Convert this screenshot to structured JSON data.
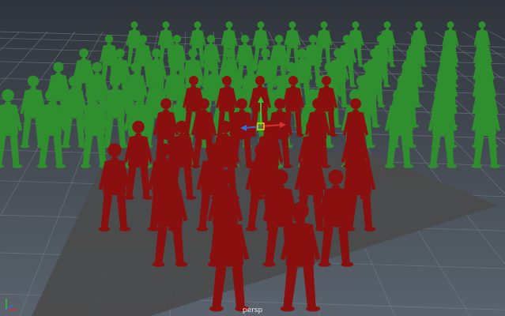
{
  "viewport": {
    "camera_label": "persp",
    "colors": {
      "background_top": "#2f343b",
      "background_bottom": "#5a636d",
      "grid_line": "#7b8590",
      "floor_plane": "#4a4a4a",
      "green_character": "#2f8f2f",
      "red_character": "#8a1010",
      "manipulator_x": "#d63030",
      "manipulator_y": "#31c431",
      "manipulator_z": "#2c6fd6",
      "manipulator_center": "#f0d000"
    },
    "icons": {
      "axis_gizmo": "xyz-axis-icon",
      "manipulator": "move-manipulator-icon"
    }
  }
}
